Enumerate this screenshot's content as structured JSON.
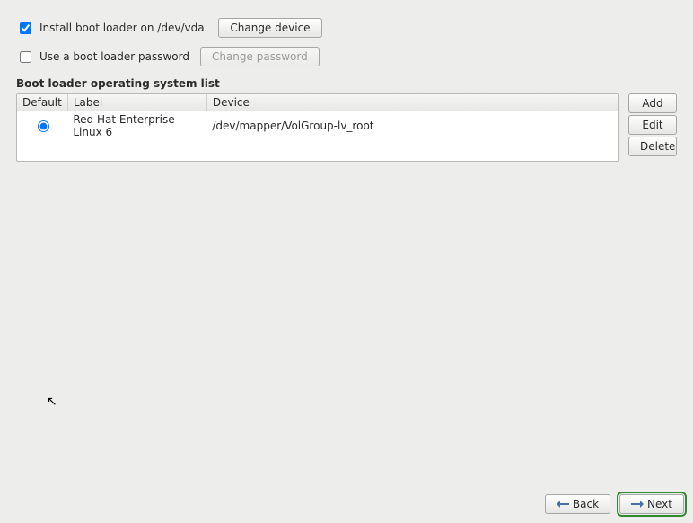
{
  "install": {
    "checked": true,
    "label": "Install boot loader on /dev/vda.",
    "change_device_btn": "Change device"
  },
  "password": {
    "checked": false,
    "label": "Use a boot loader password",
    "change_password_btn": "Change password"
  },
  "section_title": "Boot loader operating system list",
  "table": {
    "headers": {
      "default": "Default",
      "label": "Label",
      "device": "Device"
    },
    "rows": [
      {
        "default": true,
        "label": "Red Hat Enterprise Linux 6",
        "device": "/dev/mapper/VolGroup-lv_root"
      }
    ]
  },
  "side_buttons": {
    "add": "Add",
    "edit": "Edit",
    "delete": "Delete"
  },
  "nav": {
    "back": "Back",
    "next": "Next"
  }
}
